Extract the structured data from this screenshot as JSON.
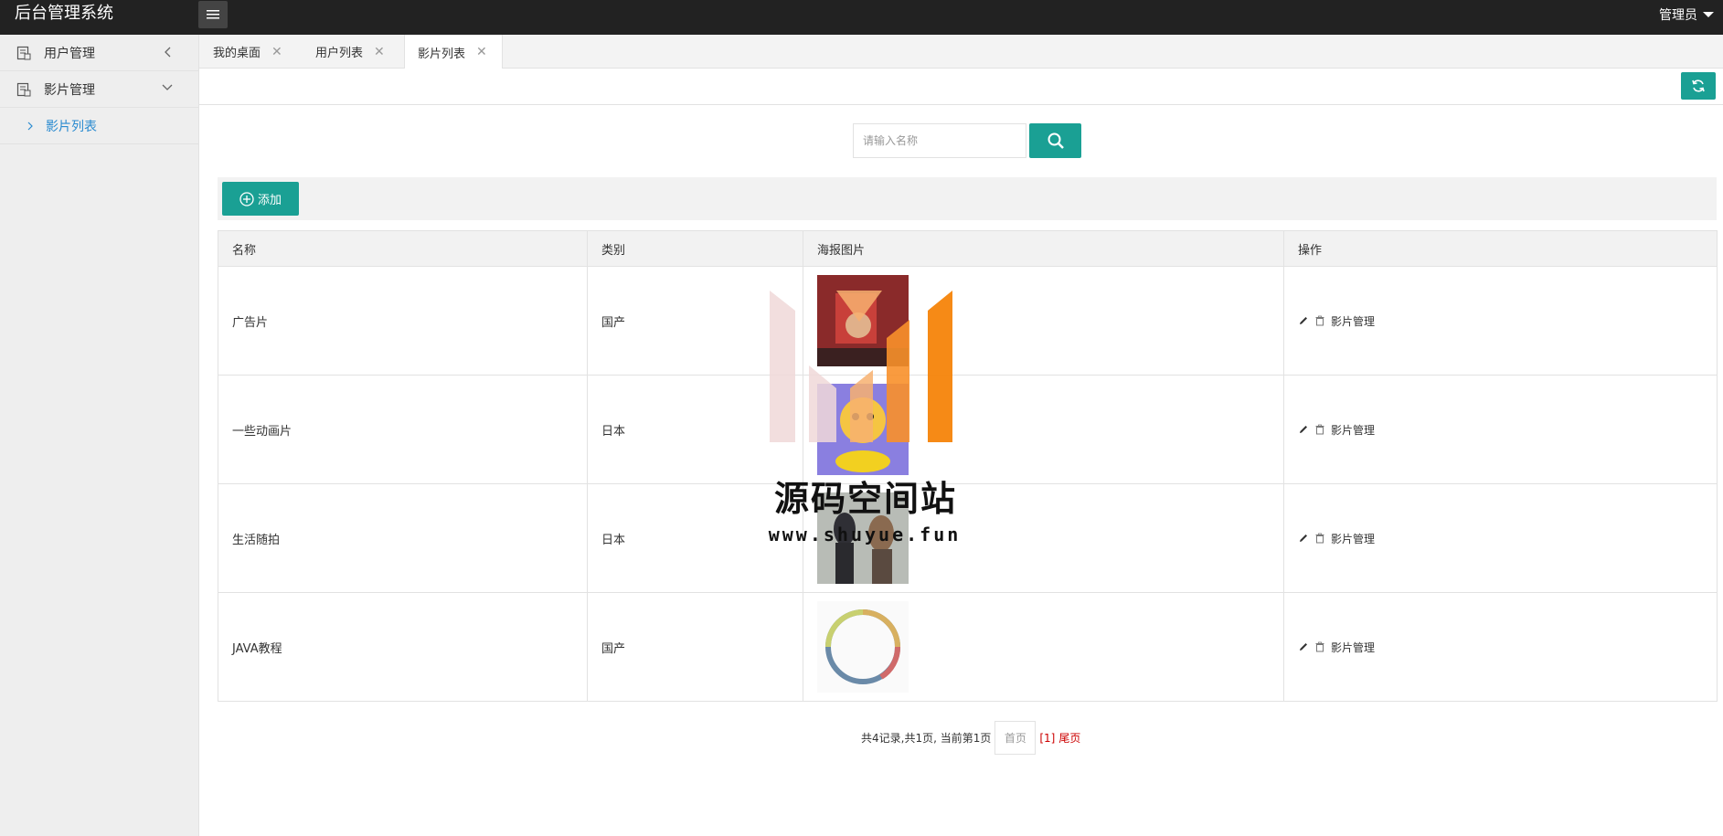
{
  "app": {
    "title": "后台管理系统",
    "user": "管理员"
  },
  "sidebar": {
    "items": [
      {
        "label": "用户管理",
        "expanded": false
      },
      {
        "label": "影片管理",
        "expanded": true
      }
    ],
    "sub": {
      "label": "影片列表"
    }
  },
  "tabs": [
    {
      "label": "我的桌面"
    },
    {
      "label": "用户列表"
    },
    {
      "label": "影片列表",
      "active": true
    }
  ],
  "search": {
    "placeholder": "请输入名称"
  },
  "actions": {
    "add_label": "添加"
  },
  "table": {
    "headers": [
      "名称",
      "类别",
      "海报图片",
      "操作"
    ],
    "rows": [
      {
        "name": "广告片",
        "category": "国产",
        "op_label": "影片管理"
      },
      {
        "name": "一些动画片",
        "category": "日本",
        "op_label": "影片管理"
      },
      {
        "name": "生活随拍",
        "category": "日本",
        "op_label": "影片管理"
      },
      {
        "name": "JAVA教程",
        "category": "国产",
        "op_label": "影片管理"
      }
    ]
  },
  "pager": {
    "summary": "共4记录,共1页, 当前第1页",
    "first": "首页",
    "current": "[1]",
    "last": "尾页"
  },
  "watermark": {
    "text": "源码空间站",
    "url": "www.shuyue.fun"
  },
  "colors": {
    "accent": "#1aa094",
    "topbar": "#222222",
    "link": "#2a8bd0"
  }
}
